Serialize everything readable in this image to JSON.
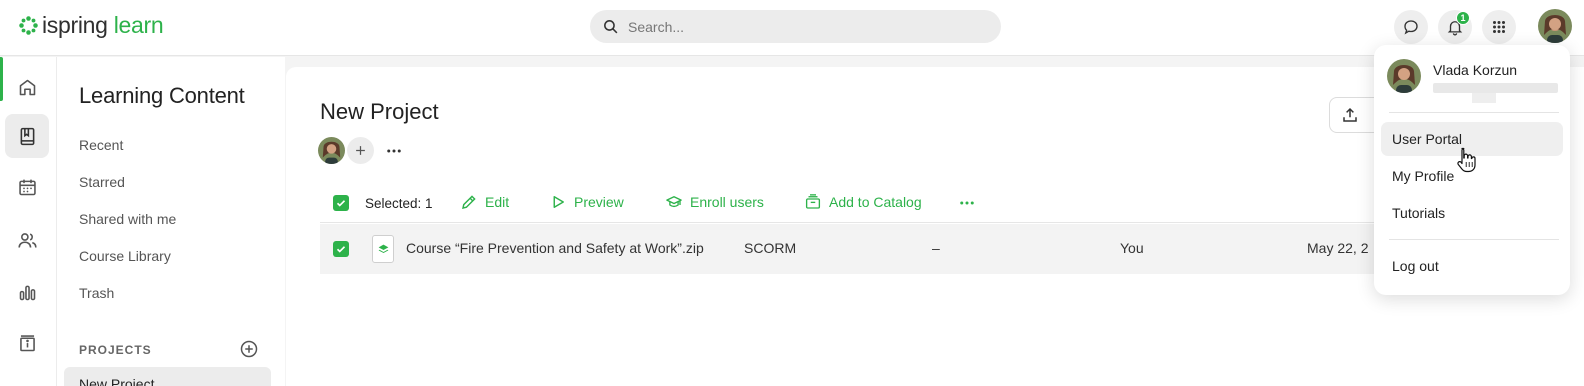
{
  "header": {
    "logo_part1": "ispring",
    "logo_part2": "learn",
    "search_placeholder": "Search...",
    "notification_count": "1",
    "brand_color": "#2db24a"
  },
  "rail": {
    "items": [
      "home-icon",
      "book-icon",
      "calendar-icon",
      "users-icon",
      "chart-icon",
      "info-icon"
    ],
    "active": "book-icon"
  },
  "sidebar": {
    "title": "Learning Content",
    "links": [
      "Recent",
      "Starred",
      "Shared with me",
      "Course Library",
      "Trash"
    ],
    "section_label": "PROJECTS",
    "current_project": "New Project"
  },
  "main": {
    "project_title": "New Project",
    "toolbar": {
      "selected_label": "Selected: 1",
      "edit": "Edit",
      "preview": "Preview",
      "enroll": "Enroll users",
      "catalog": "Add to Catalog"
    },
    "rows": [
      {
        "name": "Course “Fire Prevention and Safety at Work”.zip",
        "type": "SCORM",
        "dash": "–",
        "owner": "You",
        "date": "May 22, 2"
      }
    ]
  },
  "user_menu": {
    "user_name": "Vlada Korzun",
    "items": [
      "User Portal",
      "My Profile",
      "Tutorials"
    ],
    "logout": "Log out",
    "hovered": "User Portal"
  }
}
